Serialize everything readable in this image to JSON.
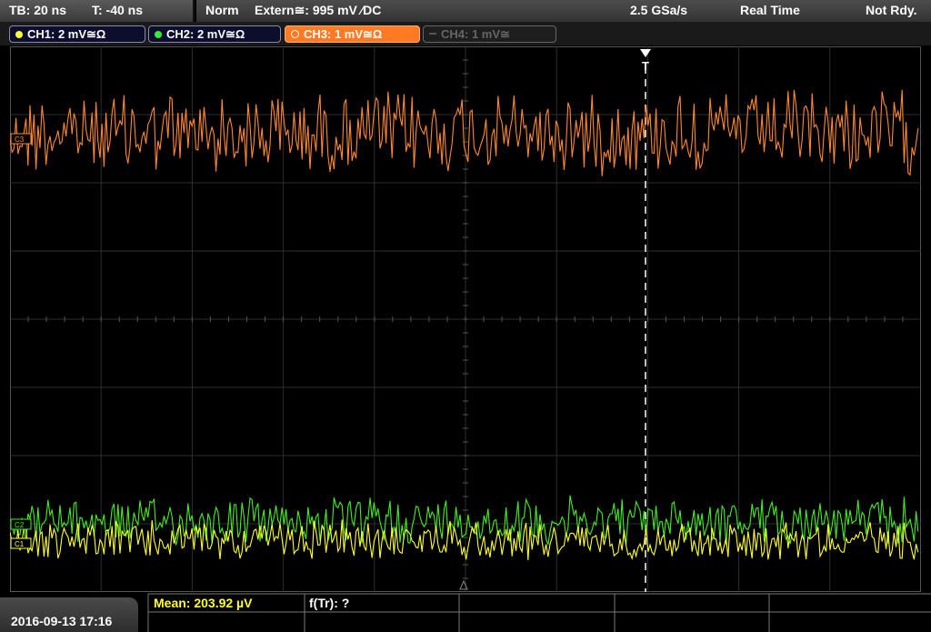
{
  "topbar": {
    "timebase": "TB: 20 ns",
    "trigger_time": "T: -40 ns",
    "mode": "Norm",
    "trigger_source": "Extern≅: 995 mV ∕DC",
    "sample_rate": "2.5 GSa/s",
    "acq_mode": "Real Time",
    "status": "Not Rdy."
  },
  "channels": [
    {
      "label": "CH1: 2 mV≅Ω",
      "color": "#ffff33",
      "active": true
    },
    {
      "label": "CH2: 2 mV≅Ω",
      "color": "#33ee33",
      "active": true
    },
    {
      "label": "CH3: 1 mV≅Ω",
      "color": "#ff8833",
      "active": true,
      "selected": true
    },
    {
      "label": "CH4: 1 mV≅",
      "color": "#666666",
      "active": false
    }
  ],
  "markers": {
    "ch3": "C3",
    "ch2": "C2",
    "ch1": "C1",
    "trigger": "T"
  },
  "footer": {
    "datetime": "2016-09-13 17:16",
    "mean": "Mean: 203.92 µV",
    "freq": "f(Tr): ?"
  },
  "colors": {
    "ch1": "#ffff33",
    "ch2": "#44ee22",
    "ch3": "#ff8833",
    "grid": "#3a3a3a"
  }
}
